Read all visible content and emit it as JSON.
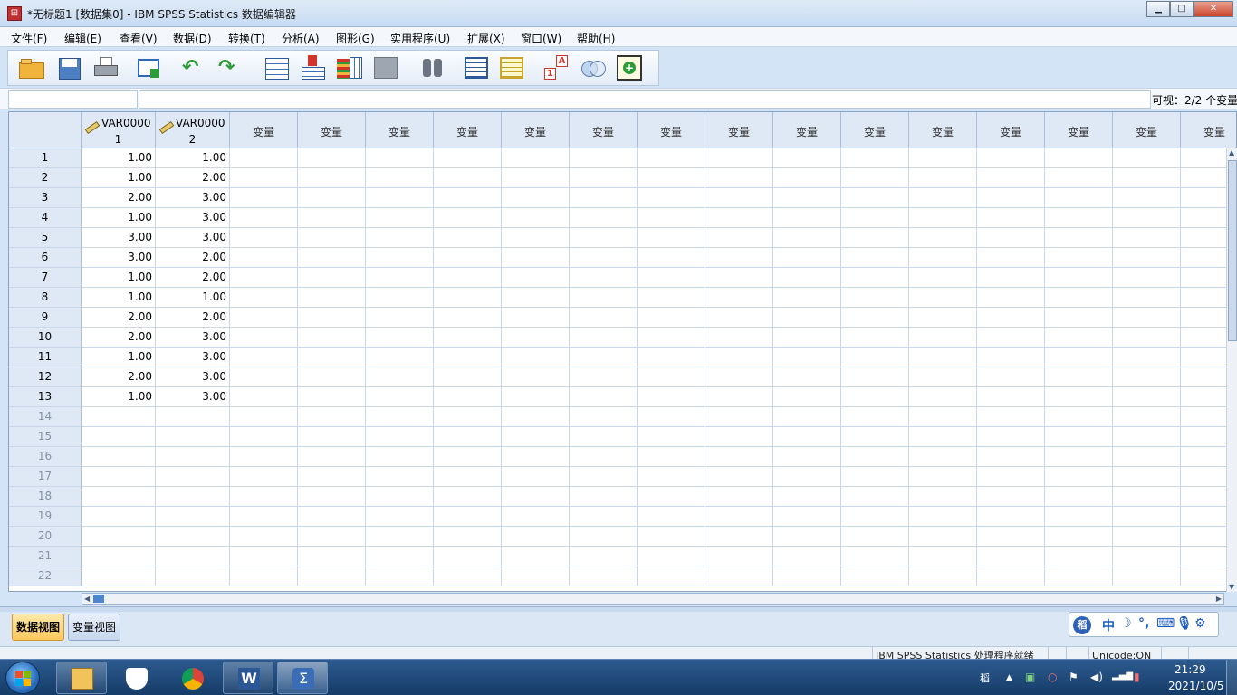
{
  "window": {
    "title": "*无标题1 [数据集0] - IBM SPSS Statistics 数据编辑器",
    "app_icon": "spss-table-icon",
    "minimize": "minimize-icon",
    "maximize": "maximize-icon",
    "close": "close-icon"
  },
  "menu": [
    "文件(F)",
    "编辑(E)",
    "查看(V)",
    "数据(D)",
    "转换(T)",
    "分析(A)",
    "图形(G)",
    "实用程序(U)",
    "扩展(X)",
    "窗口(W)",
    "帮助(H)"
  ],
  "toolbar": {
    "icons": [
      "open-folder-icon",
      "save-icon",
      "print-icon",
      "dialog-recall-icon",
      "undo-icon",
      "redo-icon",
      "goto-case-icon",
      "insert-cases-icon",
      "variables-icon",
      "run-descriptives-icon",
      "find-icon",
      "split-file-icon",
      "select-cases-icon",
      "value-labels-icon",
      "use-variable-sets-icon",
      "show-all-variables-icon"
    ]
  },
  "cell_editor": {
    "cell_reference": "",
    "cell_value": "",
    "visible_label": "可视：2/2 个变量"
  },
  "grid": {
    "var_headers": [
      {
        "line1": "VAR0000",
        "line2": "1"
      },
      {
        "line1": "VAR0000",
        "line2": "2"
      }
    ],
    "empty_header": "变量",
    "row_numbers": [
      "1",
      "2",
      "3",
      "4",
      "5",
      "6",
      "7",
      "8",
      "9",
      "10",
      "11",
      "12",
      "13",
      "14",
      "15",
      "16",
      "17",
      "18",
      "19",
      "20",
      "21",
      "22"
    ],
    "rows": [
      [
        "1.00",
        "1.00"
      ],
      [
        "1.00",
        "2.00"
      ],
      [
        "2.00",
        "3.00"
      ],
      [
        "1.00",
        "3.00"
      ],
      [
        "3.00",
        "3.00"
      ],
      [
        "3.00",
        "2.00"
      ],
      [
        "1.00",
        "2.00"
      ],
      [
        "1.00",
        "1.00"
      ],
      [
        "2.00",
        "2.00"
      ],
      [
        "2.00",
        "3.00"
      ],
      [
        "1.00",
        "3.00"
      ],
      [
        "2.00",
        "3.00"
      ],
      [
        "1.00",
        "3.00"
      ]
    ]
  },
  "view_tabs": {
    "data_view": "数据视图",
    "variable_view": "变量视图"
  },
  "ime": {
    "mode": "中",
    "icons": [
      "ime-logo-icon",
      "moon-icon",
      "punctuation-icon",
      "keyboard-icon",
      "microphone-icon",
      "gear-icon"
    ]
  },
  "status": {
    "processor": "IBM SPSS Statistics 处理程序就绪",
    "unicode": "Unicode:ON"
  },
  "taskbar": {
    "apps": [
      "file-explorer-icon",
      "foxmail-icon",
      "chrome-icon",
      "word-icon",
      "spss-icon"
    ],
    "tray_icons": [
      "ime-tray-icon",
      "show-hidden-icon",
      "network-icon",
      "sync-icon",
      "flag-icon",
      "volume-icon",
      "signal-icon",
      "battery-icon"
    ],
    "time": "21:29",
    "date": "2021/10/5"
  }
}
